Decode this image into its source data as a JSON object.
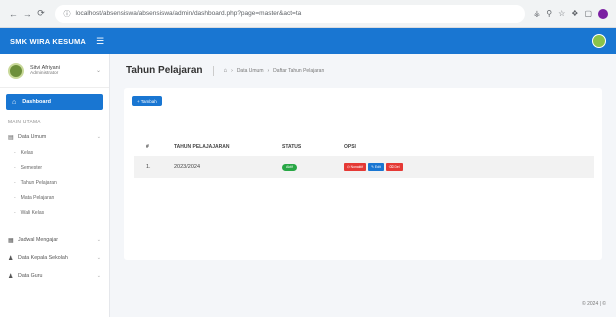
{
  "browser": {
    "url": "localhost/absensiswa/absensiswa/admin/dashboard.php?page=master&act=ta",
    "back_icon": "arrow-left",
    "forward_icon": "arrow-right",
    "reload_icon": "reload"
  },
  "topbar": {
    "brand": "SMK WIRA KESUMA",
    "menu_icon": "hamburger"
  },
  "sidebar": {
    "user_name": "Sitvi Afriyani",
    "user_role": "Administrator",
    "dashboard_label": "Dashboard",
    "section_title": "MAIN UTAMA",
    "data_umum_label": "Data Umum",
    "sub_items": [
      "Kelas",
      "Semester",
      "Tahun Pelajaran",
      "Mata Pelajaran",
      "Wali Kelas"
    ],
    "bottom_items": [
      "Jadwal Mengajar",
      "Data Kepala Sekolah",
      "Data Guru"
    ]
  },
  "page": {
    "title": "Tahun Pelajaran",
    "breadcrumb": [
      "Data Umum",
      "Daftar Tahun Pelajaran"
    ]
  },
  "card": {
    "add_button": "+ Tambah",
    "headers": [
      "#",
      "TAHUN PELAJAJARAN",
      "STATUS",
      "OPSI"
    ],
    "rows": [
      {
        "no": "1.",
        "tahun": "2023/2024",
        "status": "Aktif",
        "actions": [
          "Nonaktif",
          "Edit",
          "Del"
        ]
      }
    ]
  },
  "footer": "© 2024 | ©",
  "colors": {
    "primary": "#1976d2",
    "success": "#28a745",
    "danger": "#e53935"
  }
}
